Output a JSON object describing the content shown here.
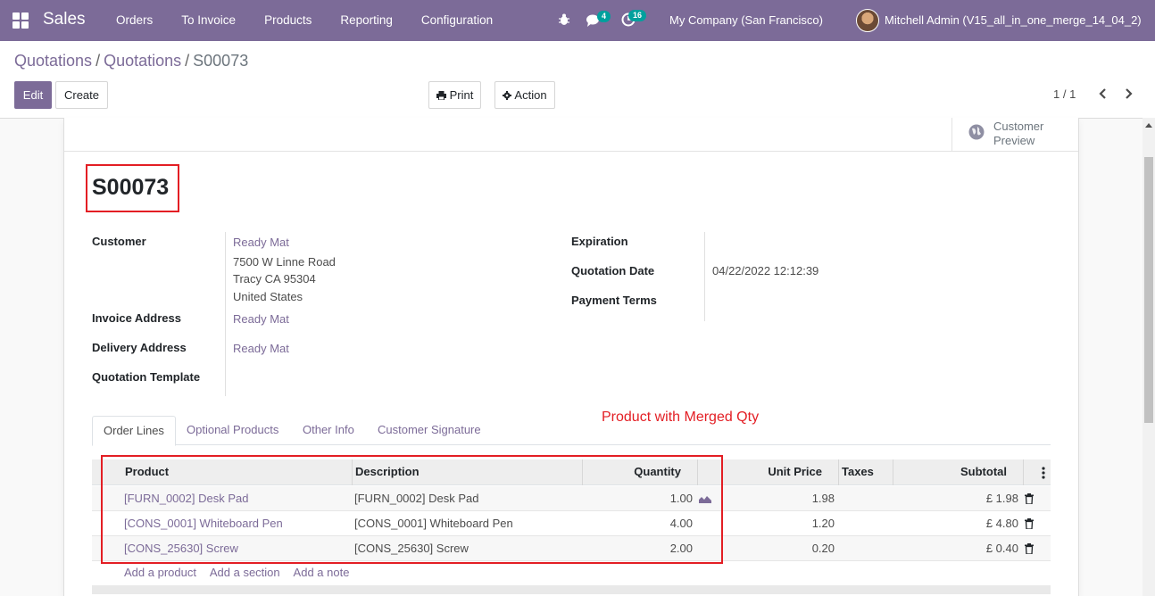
{
  "navbar": {
    "brand": "Sales",
    "menu": [
      "Orders",
      "To Invoice",
      "Products",
      "Reporting",
      "Configuration"
    ],
    "chat_count": "4",
    "activity_count": "16",
    "company": "My Company (San Francisco)",
    "user": "Mitchell Admin (V15_all_in_one_merge_14_04_2)",
    "color": "#7c6b98"
  },
  "breadcrumb": {
    "items": [
      "Quotations",
      "Quotations"
    ],
    "sep": "/",
    "current": "S00073"
  },
  "toolbar": {
    "edit": "Edit",
    "create": "Create",
    "print": "Print",
    "action": "Action",
    "pager": "1 / 1"
  },
  "stat_button": {
    "label": "Customer Preview",
    "icon": "globe-icon"
  },
  "form": {
    "title": "S00073",
    "customer_label": "Customer",
    "customer_name": "Ready Mat",
    "customer_street": "7500 W Linne Road",
    "customer_city": "Tracy CA 95304",
    "customer_country": "United States",
    "invoice_address_label": "Invoice Address",
    "invoice_address": "Ready Mat",
    "delivery_address_label": "Delivery Address",
    "delivery_address": "Ready Mat",
    "template_label": "Quotation Template",
    "expiration_label": "Expiration",
    "quotation_date_label": "Quotation Date",
    "quotation_date": "04/22/2022 12:12:39",
    "payment_terms_label": "Payment Terms"
  },
  "annotation": "Product with Merged Qty",
  "tabs": [
    "Order Lines",
    "Optional Products",
    "Other Info",
    "Customer Signature"
  ],
  "order_lines": {
    "headers": {
      "product": "Product",
      "description": "Description",
      "quantity": "Quantity",
      "unit_price": "Unit Price",
      "taxes": "Taxes",
      "subtotal": "Subtotal"
    },
    "rows": [
      {
        "product": "[FURN_0002] Desk Pad",
        "description": "[FURN_0002] Desk Pad",
        "quantity": "1.00",
        "unit_price": "1.98",
        "taxes": "",
        "subtotal": "£ 1.98"
      },
      {
        "product": "[CONS_0001] Whiteboard Pen",
        "description": "[CONS_0001] Whiteboard Pen",
        "quantity": "4.00",
        "unit_price": "1.20",
        "taxes": "",
        "subtotal": "£ 4.80"
      },
      {
        "product": "[CONS_25630] Screw",
        "description": "[CONS_25630] Screw",
        "quantity": "2.00",
        "unit_price": "0.20",
        "taxes": "",
        "subtotal": "£ 0.40"
      }
    ],
    "add_product": "Add a product",
    "add_section": "Add a section",
    "add_note": "Add a note"
  }
}
